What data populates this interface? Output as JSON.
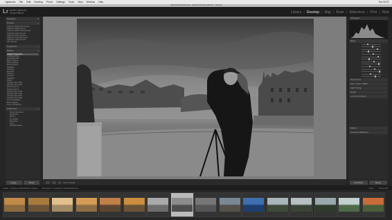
{
  "menubar": {
    "items": [
      "Lightroom",
      "File",
      "Edit",
      "Develop",
      "Photo",
      "Settings",
      "Tools",
      "View",
      "Window",
      "Help"
    ],
    "clock": "Tue 22:37"
  },
  "window": {
    "title": "LightroomRetouching.lrcat - Adobe Photoshop Lightroom - Develop"
  },
  "identity": {
    "logo": "Lr",
    "line1": "Adobe Lightroom",
    "line2": "Serge Ramelli"
  },
  "modules": {
    "items": [
      "Library",
      "Develop",
      "Map",
      "Book",
      "Slideshow",
      "Print",
      "Web"
    ],
    "active": "Develop"
  },
  "left_panel": {
    "navigator": "Navigator",
    "presets": "Presets",
    "preset_items": [
      "Lightroom B&W Filter Presets",
      "Lightroom B&W Presets",
      "Lightroom B&W Toned Presets",
      "Lightroom Color Presets",
      "Lightroom Effect Presets",
      "Lightroom General Presets",
      "Lightroom Video Presets",
      "User Presets"
    ],
    "snapshots": "Snapshots",
    "history": "History",
    "history_items": [
      "Upright: Perspective",
      "Graduated Filter",
      "Graduated Filter",
      "Black Clipping",
      "White Clipping",
      "Black Clipping",
      "Highlights",
      "Shadows",
      "Exposure",
      "Contrast",
      "Shadows",
      "Highlights",
      "Clarity",
      "Change Color Label",
      "Change Color Label",
      "Sharpening Cut",
      "Sharpening Cut",
      "Change Color Label",
      "Change Color Label",
      "Change Color Label",
      "Change Color Label",
      "Crop & Straighten",
      "Black Clipping",
      "Import (2/14/2013)"
    ],
    "collections": "Collections",
    "collection_items": [
      "Smart Collections",
      "60 Minutes",
      "Birds 3",
      "Fun Wright",
      "Main Shot",
      "Tests",
      "Wedding Gallery"
    ]
  },
  "left_buttons": {
    "copy": "Copy...",
    "paste": "Paste"
  },
  "toolbar": {
    "soft_proofing": "Soft Proofing"
  },
  "right_panel": {
    "histogram": "Histogram",
    "basic": "Basic",
    "tone_curve": "Tone Curve",
    "hsl": "HSL / Color / B&W",
    "split_toning": "Split Toning",
    "detail": "Detail",
    "lens_corrections": "Lens Corrections",
    "effects": "Effects",
    "camera_calibration": "Camera Calibration"
  },
  "right_buttons": {
    "previous": "Previous",
    "reset": "Reset"
  },
  "filmstrip": {
    "source": "Folder : Lightroom Retouching Videos",
    "count": "30 photos / 1 selected / DSC04442.dng",
    "filter_label": "Filter :",
    "filter_value": "Filters Off",
    "thumbnails": [
      {
        "tone": "#8a6a3e",
        "sky": "#c08a48"
      },
      {
        "tone": "#6e5437",
        "sky": "#a87b3c"
      },
      {
        "tone": "#a28a66",
        "sky": "#e2c08e"
      },
      {
        "tone": "#8c6d44",
        "sky": "#d49c55"
      },
      {
        "tone": "#5c4530",
        "sky": "#c08048"
      },
      {
        "tone": "#6a5236",
        "sky": "#cc8d3e"
      },
      {
        "tone": "#6d6d6d",
        "sky": "#aaa"
      },
      {
        "tone": "#4e4e4e",
        "sky": "#8c8c8c"
      },
      {
        "tone": "#555",
        "sky": "#777"
      },
      {
        "tone": "#54504a",
        "sky": "#7a8896"
      },
      {
        "tone": "#1d3e6e",
        "sky": "#3e6fb0"
      },
      {
        "tone": "#3c4a38",
        "sky": "#a9b6bb"
      },
      {
        "tone": "#394437",
        "sky": "#b7c0c2"
      },
      {
        "tone": "#2f3a2d",
        "sky": "#9aa9ad"
      },
      {
        "tone": "#4d6a48",
        "sky": "#c2d0cf"
      },
      {
        "tone": "#4a5e3a",
        "sky": "#c96c3a"
      }
    ]
  }
}
